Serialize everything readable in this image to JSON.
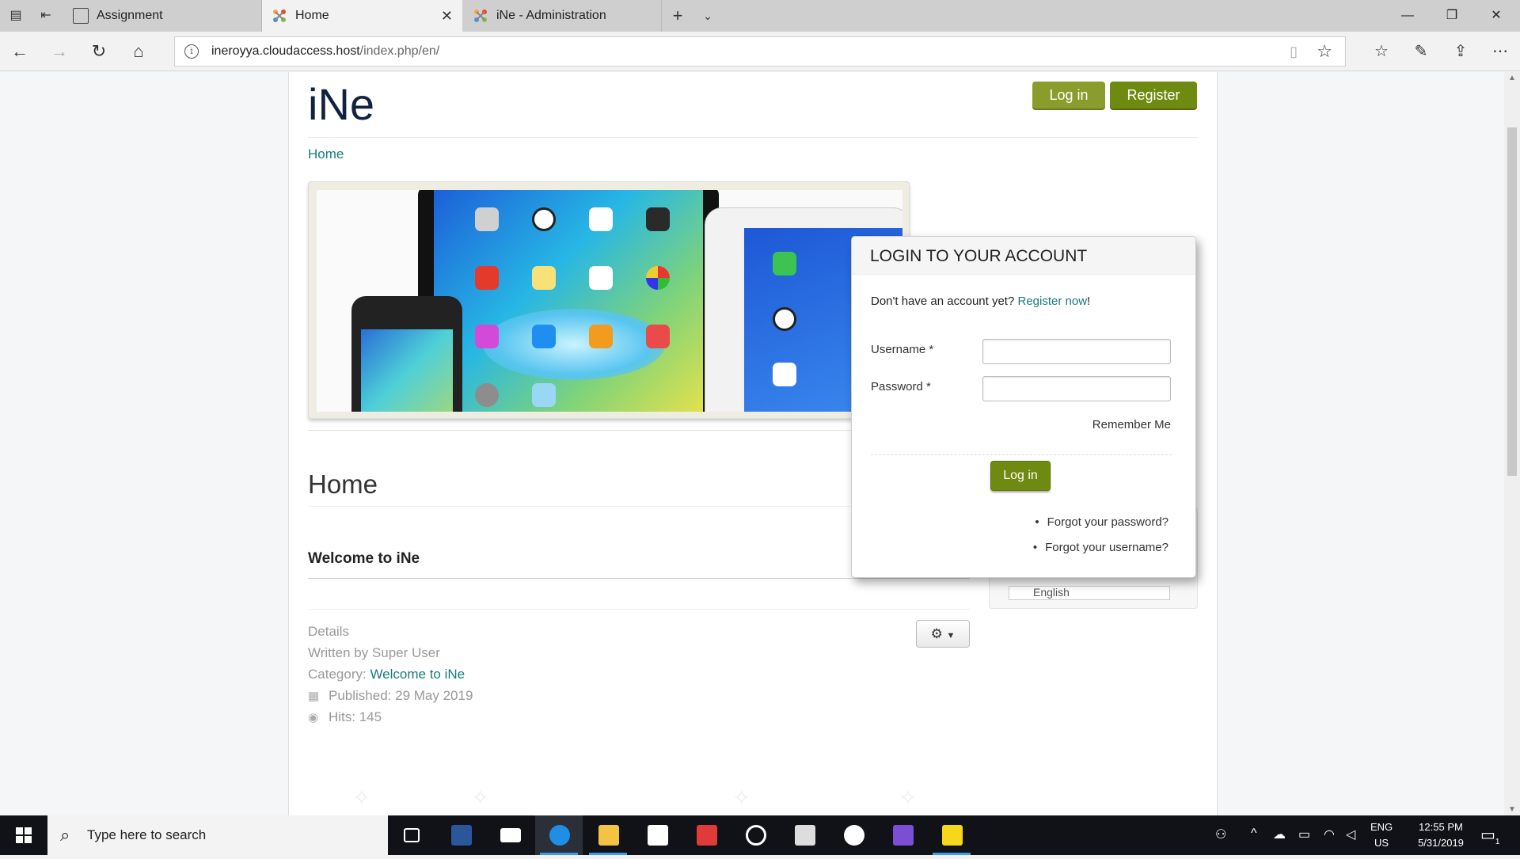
{
  "browser": {
    "tabs": [
      {
        "label": "Assignment"
      },
      {
        "label": "Home"
      },
      {
        "label": "iNe - Administration"
      }
    ],
    "address": {
      "host": "ineroyya.cloudaccess.host",
      "path": "/index.php/en/"
    }
  },
  "site": {
    "brand": "iNe",
    "header": {
      "login_label": "Log in",
      "register_label": "Register"
    },
    "breadcrumb": "Home"
  },
  "article": {
    "page_title": "Home",
    "title": "Welcome to iNe",
    "details_label": "Details",
    "written_by": "Written by Super User",
    "category_prefix": "Category: ",
    "category": "Welcome to iNe",
    "published": "Published: 29 May 2019",
    "hits": "Hits: 145"
  },
  "sidebar": {
    "language": "English"
  },
  "login_popup": {
    "heading": "LOGIN TO YOUR ACCOUNT",
    "question": "Don't have an account yet?",
    "register_link": "Register now",
    "register_suffix": "!",
    "username_label": "Username *",
    "password_label": "Password *",
    "remember_label": "Remember Me",
    "login_button": "Log in",
    "forgot_password": "Forgot your password?",
    "forgot_username": "Forgot your username?"
  },
  "taskbar": {
    "search_placeholder": "Type here to search",
    "lang_top": "ENG",
    "lang_bottom": "US",
    "time": "12:55 PM",
    "date": "5/31/2019",
    "notification_count": "1"
  },
  "colors": {
    "brand_dark": "#10223e",
    "accent_green": "#6f8a10",
    "link_teal": "#1a7a7a"
  }
}
